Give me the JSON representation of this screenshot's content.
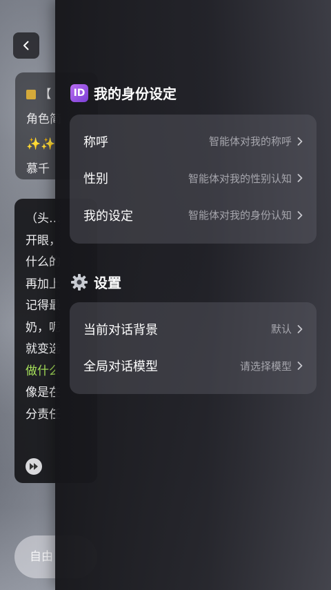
{
  "background_chat": {
    "info_card": {
      "rows": [
        "【",
        "角色简",
        "✨✨",
        "慕千"
      ]
    },
    "bubble_lines": [
      {
        "text": "（头…",
        "color": "#f0f0f2"
      },
      {
        "text": "开眼，",
        "color": "#f0f0f2"
      },
      {
        "text": "什么的",
        "color": "#f0f0f2"
      },
      {
        "text": "再加上",
        "color": "#f0f0f2"
      },
      {
        "text": "记得最",
        "color": "#f0f0f2"
      },
      {
        "text": "奶，呢",
        "color": "#f0f0f2"
      },
      {
        "text": "就变选",
        "color": "#f0f0f2"
      },
      {
        "text": "做什么",
        "color": "#a6e05a"
      },
      {
        "text": "像是在",
        "color": "#f0f0f2"
      },
      {
        "text": "分责任",
        "color": "#f0f0f2"
      }
    ],
    "input_placeholder": "自由"
  },
  "drawer": {
    "identity_section": {
      "icon": "id-badge-icon",
      "icon_text": "ID",
      "title": "我的身份设定",
      "items": [
        {
          "label": "称呼",
          "value": "智能体对我的称呼"
        },
        {
          "label": "性别",
          "value": "智能体对我的性别认知"
        },
        {
          "label": "我的设定",
          "value": "智能体对我的身份认知"
        }
      ]
    },
    "settings_section": {
      "icon": "gear-icon",
      "title": "设置",
      "items": [
        {
          "label": "当前对话背景",
          "value": "默认"
        },
        {
          "label": "全局对话模型",
          "value": "请选择模型"
        }
      ]
    }
  },
  "colors": {
    "accent_purple": "#9b59e6",
    "green_text": "#a6e05a",
    "secondary_text": "#a6a6ad"
  }
}
